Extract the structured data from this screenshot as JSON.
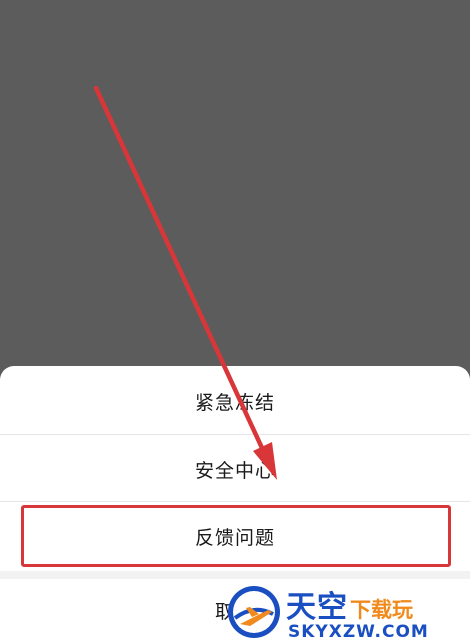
{
  "sheet": {
    "items": [
      {
        "label": "紧急冻结"
      },
      {
        "label": "安全中心"
      },
      {
        "label": "反馈问题"
      },
      {
        "label": "取消"
      }
    ]
  },
  "annotation": {
    "color": "#d9363a",
    "highlighted_item": "反馈问题"
  },
  "watermark": {
    "main": "天空",
    "sub": "下载玩",
    "domain": "SKYXZW.COM",
    "colors": {
      "primary": "#1a4fc2",
      "accent": "#f08a1c"
    }
  }
}
